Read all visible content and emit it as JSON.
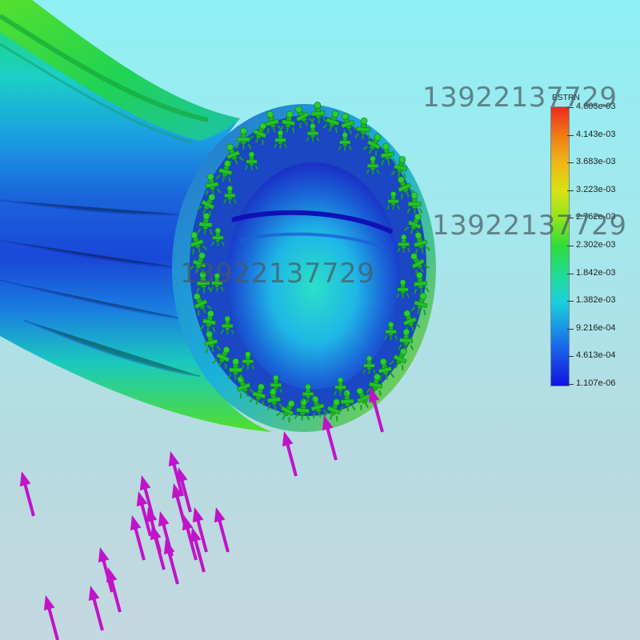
{
  "legend": {
    "title": "ESTRN",
    "labels": [
      "4.603e-03",
      "4.143e-03",
      "3.683e-03",
      "3.223e-03",
      "2.762e-03",
      "2.302e-03",
      "1.842e-03",
      "1.382e-03",
      "9.216e-04",
      "4.613e-04",
      "1.107e-06"
    ]
  },
  "watermarks": [
    "13922137729",
    "13922137729",
    "13922137729"
  ],
  "colors": {
    "background_top": "#8ff0f4",
    "background_bottom": "#c4d8df",
    "fixture_green": "#1fb526",
    "load_arrow_magenta": "#c113c9"
  },
  "icons": {
    "fixture": "green-fixture-restraint-icon",
    "load": "magenta-load-arrow-icon"
  }
}
